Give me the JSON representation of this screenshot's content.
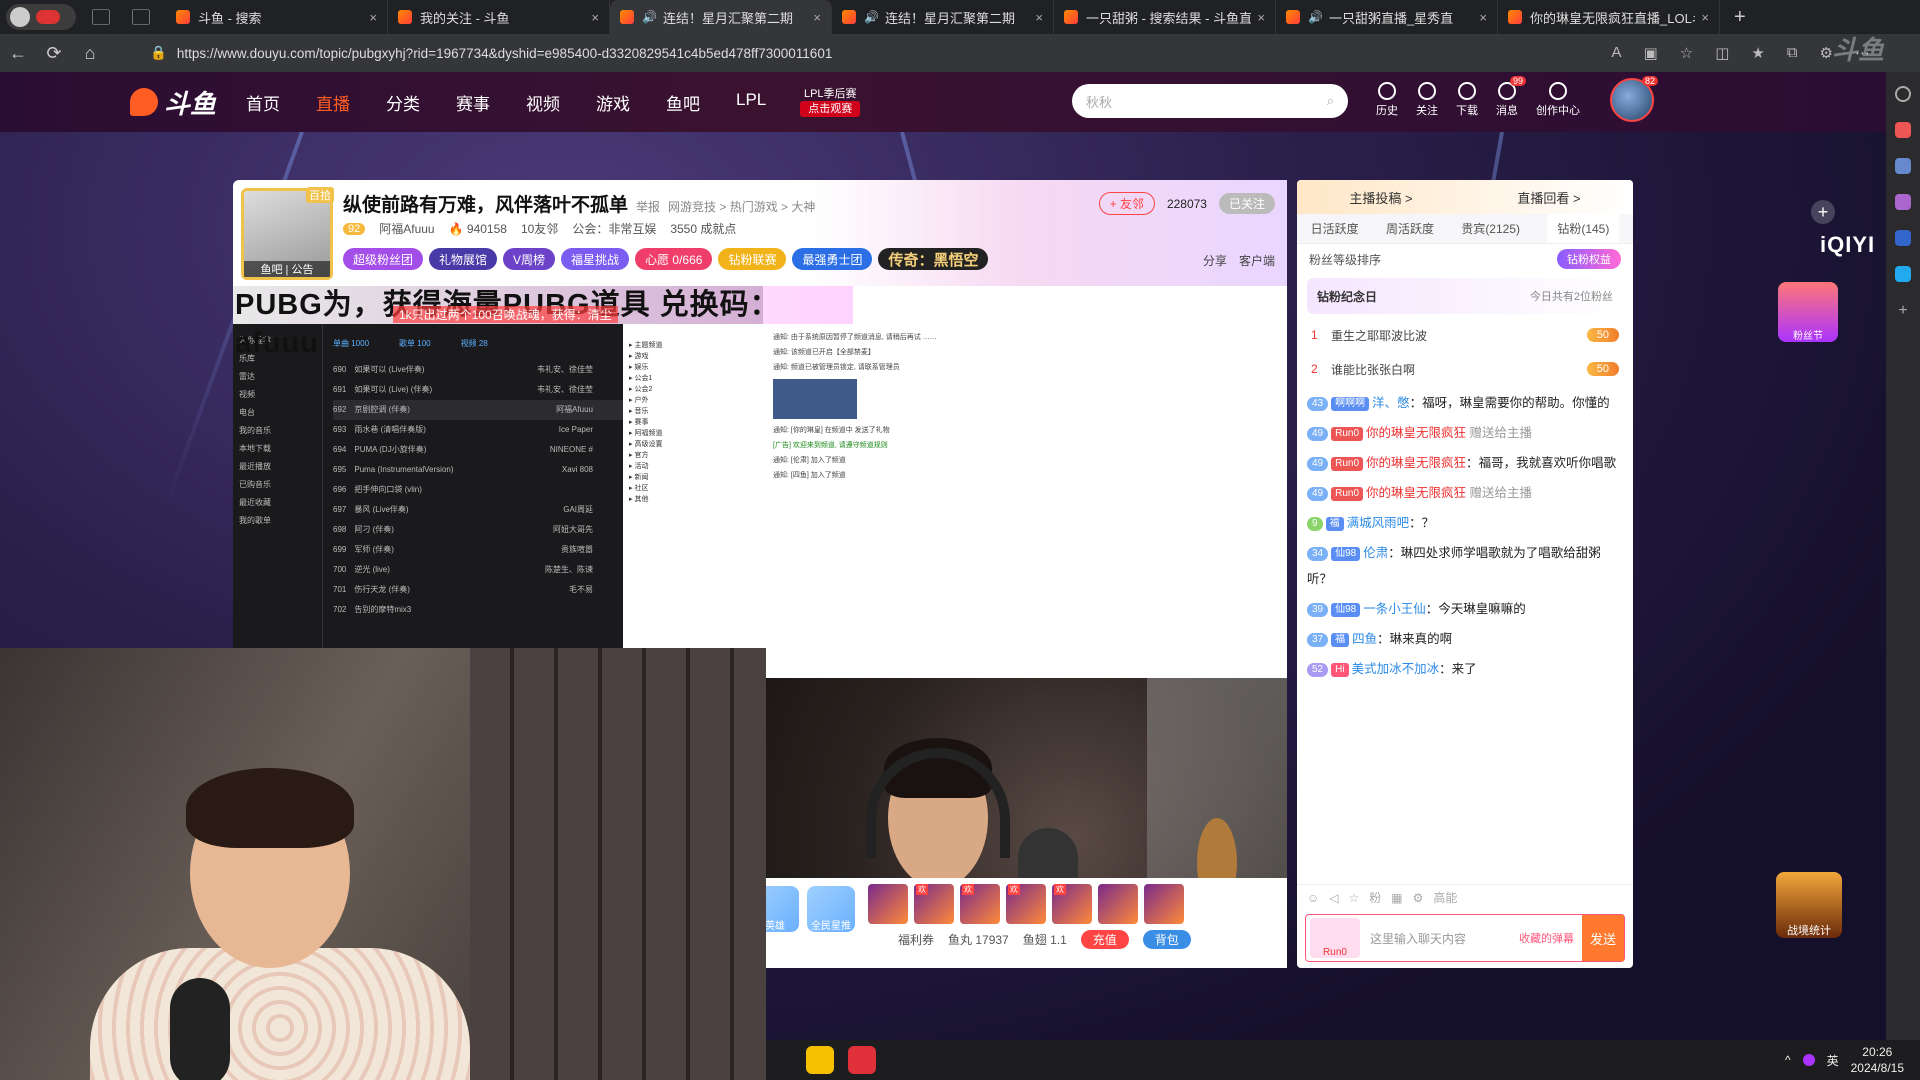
{
  "browser": {
    "tabs": [
      {
        "title": "斗鱼 - 搜索",
        "audio": false,
        "active": false
      },
      {
        "title": "我的关注 - 斗鱼",
        "audio": false,
        "active": false
      },
      {
        "title": "连结！星月汇聚第二期",
        "audio": true,
        "active": true
      },
      {
        "title": "连结！星月汇聚第二期",
        "audio": true,
        "active": false
      },
      {
        "title": "一只甜粥 - 搜索结果 - 斗鱼直",
        "audio": false,
        "active": false
      },
      {
        "title": "一只甜粥直播_星秀直",
        "audio": true,
        "active": false
      },
      {
        "title": "你的琳皇无限疯狂直播_LOL斗",
        "audio": false,
        "active": false
      }
    ],
    "new_tab": "+",
    "url": "https://www.douyu.com/topic/pubgxyhj?rid=1967734&dyshid=e985400-d3320829541c4b5ed478ff7300011601"
  },
  "header": {
    "logo": "斗鱼",
    "nav": [
      "首页",
      "直播",
      "分类",
      "赛事",
      "视频",
      "游戏",
      "鱼吧",
      "LPL"
    ],
    "active_nav": "直播",
    "lpl_badge": {
      "top": "LPL季后赛",
      "bottom": "点击观赛"
    },
    "search_placeholder": "秋秋",
    "icons": [
      {
        "name": "history",
        "label": "历史"
      },
      {
        "name": "follow",
        "label": "关注"
      },
      {
        "name": "download",
        "label": "下载"
      },
      {
        "name": "message",
        "label": "消息",
        "badge": "99"
      },
      {
        "name": "creator",
        "label": "创作中心"
      }
    ],
    "avatar_badge": "82"
  },
  "room": {
    "avatar_tag": "百拾",
    "avatar_footer": "鱼吧 | 公告",
    "title": "纵使前路有万难，风伴落叶不孤单",
    "report": "举报",
    "category": "网游竞技 > 热门游戏 > 大神",
    "level": "92",
    "streamer": "阿福Afuuu",
    "heat": "940158",
    "friends": "10友邻",
    "guild": "公会：非常互娱",
    "achievement": "3550 成就点",
    "friend_btn": "+ 友邻",
    "followers": "228073",
    "follow_state": "已关注",
    "badges": [
      "超级粉丝团",
      "礼物展馆",
      "V周榜",
      "福星挑战",
      "心愿 0/666",
      "钻粉联赛",
      "最强勇士团"
    ],
    "legend_tag": "传奇：黑悟空",
    "share": "分享",
    "client": "客户端"
  },
  "video": {
    "announcement": "PUBG为，获得海量PUBG道具 兑换码：afuuu",
    "announcement_sub": "1k只出过两个100召唤战魂，获得：清尘",
    "music_tabs": [
      "单曲 1000",
      "歌单 100",
      "视频 28"
    ],
    "songs": [
      {
        "no": "690",
        "title": "如果可以 (Live伴奏)",
        "artist": "韦礼安、徐佳莹"
      },
      {
        "no": "691",
        "title": "如果可以 (Live) (伴奏)",
        "artist": "韦礼安、徐佳莹"
      },
      {
        "no": "692",
        "title": "京剧腔调 (伴奏)",
        "artist": "阿福Afuuu"
      },
      {
        "no": "693",
        "title": "雨水巷 (清唱伴奏版)",
        "artist": "Ice Paper"
      },
      {
        "no": "694",
        "title": "PUMA (DJ小旋伴奏)",
        "artist": "NINEONE #"
      },
      {
        "no": "695",
        "title": "Puma (InstrumentalVersion)",
        "artist": "Xavi 808"
      },
      {
        "no": "696",
        "title": "把手伸向口袋 (vlin)",
        "artist": ""
      },
      {
        "no": "697",
        "title": "暴风 (Live伴奏)",
        "artist": "GAI周延"
      },
      {
        "no": "698",
        "title": "阿刁 (伴奏)",
        "artist": "阿妞大哥先"
      },
      {
        "no": "699",
        "title": "军师 (伴奏)",
        "artist": "贵族喧嚣"
      },
      {
        "no": "700",
        "title": "逆光 (live)",
        "artist": "陈楚生、陈谏"
      },
      {
        "no": "701",
        "title": "伤行天龙 (伴奏)",
        "artist": "毛不易"
      },
      {
        "no": "702",
        "title": "告别的摩特mix3",
        "artist": ""
      }
    ]
  },
  "gift_bar": {
    "promos": [
      "英雄",
      "全民星推"
    ],
    "voucher": "福利券",
    "fish_balls": "鱼丸 17937",
    "fish_fins": "鱼翅 1.1",
    "charge": "充值",
    "bag": "背包"
  },
  "chat": {
    "top_tabs": [
      "主播投稿 >",
      "直播回看 >"
    ],
    "tabs": [
      "日活跃度",
      "周活跃度",
      "贵宾(2125)",
      "钻粉(145)"
    ],
    "fan_rank": "粉丝等级排序",
    "fan_btn": "钻粉权益",
    "memorial_title": "钻粉纪念日",
    "memorial_count": "今日共有2位粉丝",
    "ranks": [
      {
        "n": "1",
        "name": "重生之耶耶波比波",
        "tag": "50"
      },
      {
        "n": "2",
        "name": "谁能比张张白啊",
        "tag": "50"
      }
    ],
    "messages": [
      {
        "lv": "43",
        "fan": "啊啊啊",
        "user": "洋、憋",
        "text": "福呀，琳皇需要你的帮助。你懂的"
      },
      {
        "lv": "49",
        "fan": "Run0",
        "user": "你的琳皇无限疯狂",
        "text": "赠送给主播",
        "gift": true
      },
      {
        "lv": "49",
        "fan": "Run0",
        "user": "你的琳皇无限疯狂",
        "text": "福哥，我就喜欢听你唱歌"
      },
      {
        "lv": "49",
        "fan": "Run0",
        "user": "你的琳皇无限疯狂",
        "text": "赠送给主播",
        "gift": true
      },
      {
        "lv": "9",
        "fan": "福",
        "user": "满城风雨吧",
        "text": "？"
      },
      {
        "lv": "34",
        "fan": "仙98",
        "user": "伦肃",
        "text": "琳四处求师学唱歌就为了唱歌给甜粥听？"
      },
      {
        "lv": "39",
        "fan": "仙98",
        "user": "一条小王仙",
        "text": "今天琳皇嘛嘛的"
      },
      {
        "lv": "37",
        "fan": "福",
        "user": "四鱼",
        "text": "琳来真的啊"
      },
      {
        "lv": "52",
        "fan": "Hi",
        "user": "美式加冰不加冰",
        "text": "来了"
      }
    ],
    "tools": [
      "高能"
    ],
    "input_level": "Run0",
    "input_placeholder": "这里输入聊天内容",
    "input_hint": "收藏的弹幕",
    "send": "发送"
  },
  "overlay": {
    "iqiyi": "iQIYI",
    "fan_festival": "粉丝节",
    "war": "战境统计",
    "watermark": "斗鱼"
  },
  "taskbar": {
    "time": "20:26",
    "date": "2024/8/15",
    "ime": "英"
  },
  "colors": {
    "accent": "#ff5d23",
    "header_bg": "#2a0d33",
    "danger": "#e33333"
  }
}
